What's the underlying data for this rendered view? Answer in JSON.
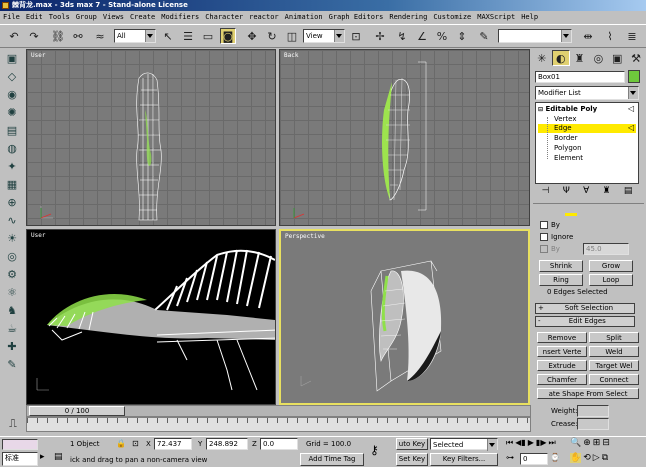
{
  "window": {
    "title": "棘背龙.max - 3ds max 7 - Stand-alone License"
  },
  "menu": [
    "File",
    "Edit",
    "Tools",
    "Group",
    "Views",
    "Create",
    "Modifiers",
    "Character",
    "reactor",
    "Animation",
    "Graph Editors",
    "Rendering",
    "Customize",
    "MAXScript",
    "Help"
  ],
  "toolbar": {
    "selection_filter": "All",
    "ref_coord": "View"
  },
  "viewports": {
    "top_left": "User",
    "top_right": "Back",
    "bottom_left": "User",
    "bottom_right": "Perspective"
  },
  "command_panel": {
    "object_name": "Box01",
    "object_color": "#6ec83c",
    "modifier_list": "Modifier List",
    "stack": {
      "root": "Editable Poly",
      "items": [
        "Vertex",
        "Edge",
        "Border",
        "Polygon",
        "Element"
      ],
      "selected": "Edge"
    },
    "selection": {
      "by_vertex": "By",
      "ignore_backfacing": "Ignore",
      "by_angle": "By",
      "angle_value": "45.0",
      "shrink": "Shrink",
      "grow": "Grow",
      "ring": "Ring",
      "loop": "Loop",
      "status": "0 Edges Selected"
    },
    "soft_selection": "Soft Selection",
    "edit_edges": {
      "title": "Edit Edges",
      "remove": "Remove",
      "split": "Split",
      "insert_vertex": "nsert Verte",
      "weld": "Weld",
      "extrude": "Extrude",
      "target_weld": "Target Wel",
      "chamfer": "Chamfer",
      "connect": "Connect",
      "create_shape": "ate Shape From Select",
      "weight_label": "Weight:",
      "crease_label": "Crease:"
    }
  },
  "timeline": {
    "frame_label": "0 / 100"
  },
  "status": {
    "objects": "1 Object",
    "x_label": "X",
    "x": "72.437",
    "y_label": "Y",
    "y": "248.892",
    "z_label": "Z",
    "z": "0.0",
    "grid": "Grid = 100.0",
    "prompt": "ick and drag to pan a non-camera view",
    "add_time_tag": "Add Time Tag",
    "auto_key": "uto Key",
    "set_key": "Set Key",
    "key_mode": "Selected",
    "key_filters": "Key Filters...",
    "frame": "0",
    "maxscript": "标准"
  }
}
